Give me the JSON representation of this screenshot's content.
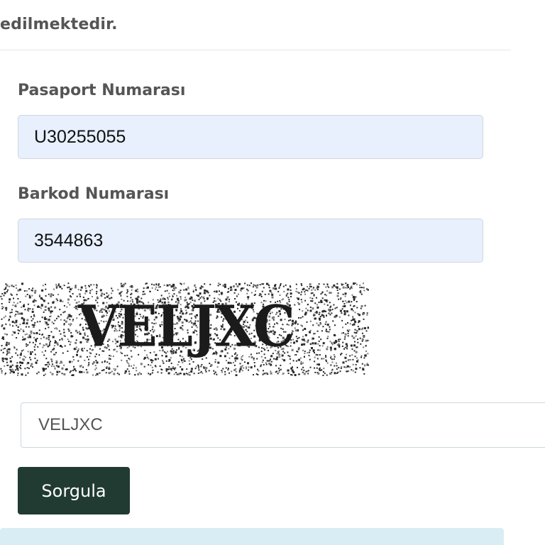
{
  "intro": {
    "clipped_line": "……………………………………………………………………",
    "last_line": "edilmektedir."
  },
  "passport": {
    "label": "Pasaport Numarası",
    "value": "U30255055"
  },
  "barcode": {
    "label": "Barkod Numarası",
    "value": "3544863"
  },
  "captcha": {
    "image_text": "VELJXC",
    "input_value": "VELJXC"
  },
  "submit": {
    "label": "Sorgula"
  },
  "colors": {
    "button_bg": "#213b33",
    "autofill_bg": "#e8f0fe",
    "info_bg": "#d9eef4"
  }
}
